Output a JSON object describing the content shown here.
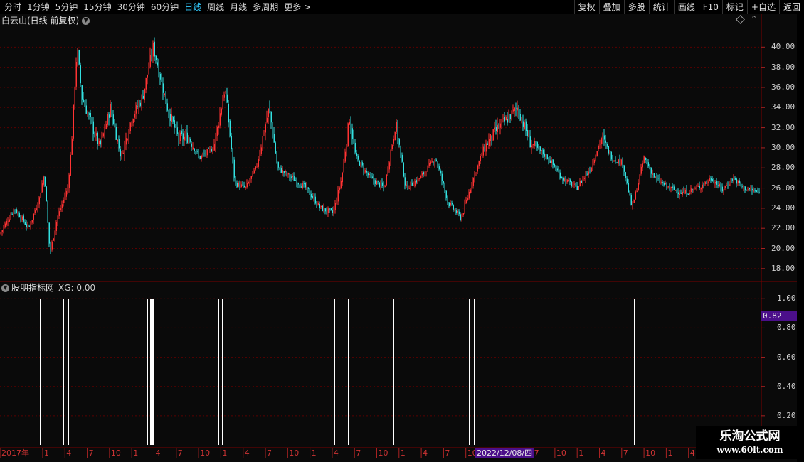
{
  "toolbar": {
    "periods": [
      "分时",
      "1分钟",
      "5分钟",
      "15分钟",
      "30分钟",
      "60分钟",
      "日线",
      "周线",
      "月线",
      "多周期",
      "更多 >"
    ],
    "active_period": "日线",
    "actions": [
      "复权",
      "叠加",
      "多股",
      "统计",
      "画线",
      "F10",
      "标记",
      "+自选",
      "返回"
    ]
  },
  "price_panel": {
    "title": "白云山(日线 前复权)",
    "y_labels": [
      "40.00",
      "38.00",
      "36.00",
      "34.00",
      "32.00",
      "30.00",
      "28.00",
      "26.00",
      "24.00",
      "22.00",
      "20.00",
      "18.00"
    ]
  },
  "indicator_panel": {
    "title": "股朋指标网",
    "xg_label": "XG: 0.00",
    "y_labels": [
      "1.00",
      "0.80",
      "0.60",
      "0.40",
      "0.20"
    ],
    "cursor_value": "0.82"
  },
  "date_axis": {
    "labels": [
      "2017年",
      "1",
      "4",
      "7",
      "10",
      "1",
      "4",
      "7",
      "10",
      "1",
      "4",
      "7",
      "10",
      "1",
      "4",
      "7",
      "10",
      "1",
      "4",
      "7",
      "10",
      "1",
      "4",
      "7",
      "10",
      "1",
      "4",
      "7",
      "10",
      "1",
      "4"
    ],
    "cursor_date": "2022/12/08/四"
  },
  "watermark": {
    "title": "乐淘公式网",
    "url": "www.60lt.com"
  },
  "colors": {
    "up": "#ff3333",
    "down": "#33e0e0",
    "active": "#33ccff",
    "grid": "#5a0000",
    "signal": "#ffffff",
    "highlight": "#4b0f8a"
  },
  "chart_data": [
    {
      "type": "line",
      "name": "price",
      "x": [
        0,
        20,
        40,
        55,
        62,
        70,
        80,
        95,
        100,
        108,
        115,
        125,
        140,
        155,
        170,
        185,
        200,
        215,
        222,
        235,
        250,
        265,
        280,
        300,
        316,
        330,
        345,
        360,
        378,
        390,
        410,
        430,
        450,
        468,
        480,
        491,
        500,
        520,
        540,
        556,
        570,
        590,
        612,
        630,
        648,
        665,
        680,
        700,
        715,
        727,
        745,
        770,
        790,
        810,
        830,
        845,
        860,
        875,
        888,
        895,
        905,
        920,
        940,
        960,
        980,
        1000,
        1015,
        1030,
        1045,
        1068
      ],
      "y": [
        21.5,
        24,
        22,
        25,
        27.5,
        19.5,
        23,
        26,
        30,
        40,
        35,
        33,
        30,
        34,
        29,
        33,
        35,
        40,
        38,
        34,
        31,
        31,
        29,
        30,
        36,
        26.5,
        26,
        28,
        34,
        28,
        27,
        26,
        24,
        23.5,
        27,
        33,
        29,
        27,
        26,
        32.5,
        26,
        27,
        29,
        24.5,
        23,
        27,
        30,
        32,
        33,
        34,
        30.5,
        29,
        27,
        26,
        28,
        31,
        29,
        28.5,
        24,
        26,
        29,
        27,
        26,
        25.5,
        26,
        27,
        25.8,
        27,
        26,
        25.5
      ],
      "ylim": [
        17,
        42
      ]
    },
    {
      "type": "bar",
      "name": "XG",
      "x": [
        57,
        89,
        96,
        207,
        212,
        215,
        307,
        313,
        470,
        490,
        553,
        660,
        667,
        892
      ],
      "values": [
        1,
        1,
        1,
        1,
        1,
        1,
        1,
        1,
        1,
        1,
        1,
        1,
        1,
        1
      ],
      "ylim": [
        0,
        1.05
      ]
    }
  ]
}
